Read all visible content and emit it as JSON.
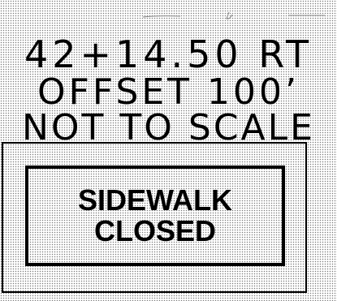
{
  "callout": {
    "station": "42+14.50 RT",
    "offset": "OFFSET 100’",
    "scale_note": "NOT TO SCALE"
  },
  "sign": {
    "line1": "SIDEWALK",
    "line2": "CLOSED"
  },
  "colors": {
    "ink": "#000000",
    "background": "#ffffff",
    "hatch": "#7a7a7a"
  }
}
